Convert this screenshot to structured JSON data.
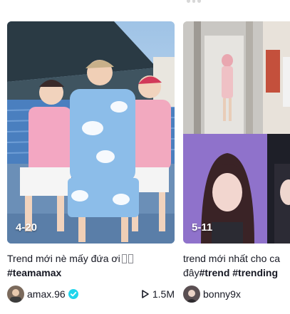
{
  "cards": [
    {
      "date": "4-20",
      "caption": "Trend mới nè mấy đứa ơi",
      "hashtags": "#teamamax",
      "author": "amax.96",
      "verified": true,
      "views": "1.5M"
    },
    {
      "date": "5-11",
      "caption": "trend mới nhất cho ca",
      "caption_line2": "đây",
      "hashtags": "#trend #trending",
      "author": "bonny9x"
    }
  ],
  "icons": {
    "play": "play-icon",
    "verified": "verified-badge-icon"
  },
  "colors": {
    "text": "#161823",
    "verified": "#20d5ec"
  }
}
